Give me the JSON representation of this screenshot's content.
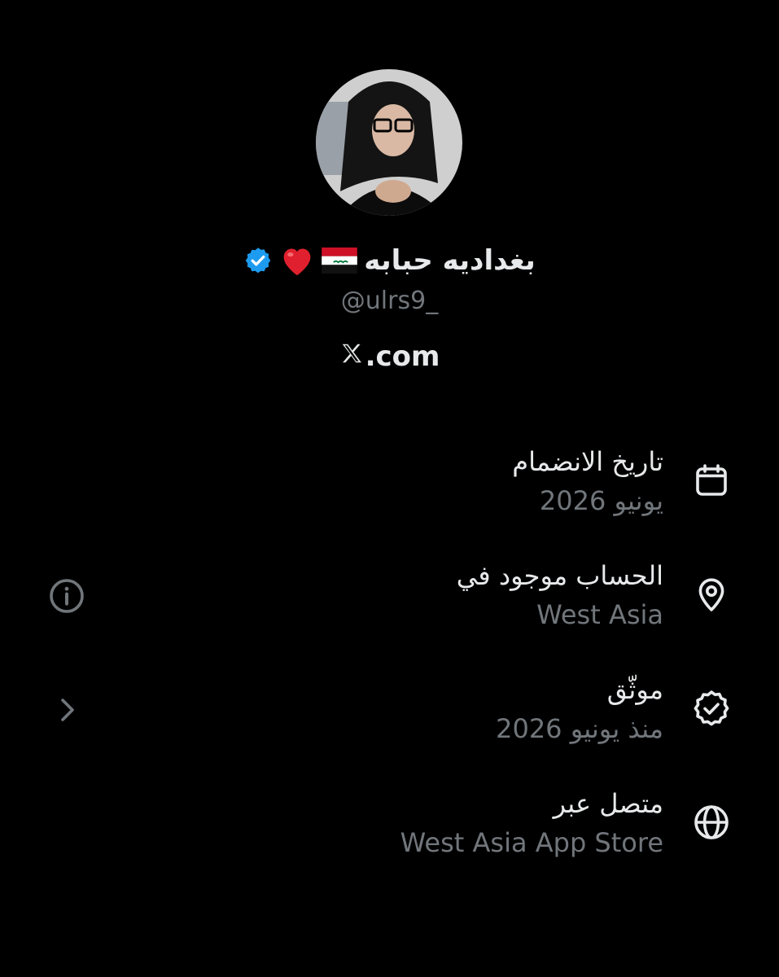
{
  "profile": {
    "display_name": "بغداديه حبابه",
    "handle": "@ulrs9_",
    "link_text": ".com",
    "icons": [
      "verified-badge-icon",
      "heart-icon",
      "iraq-flag-icon",
      "x-logo-icon"
    ]
  },
  "details": [
    {
      "label": "تاريخ الانضمام",
      "value": "يونيو 2026",
      "icon": "calendar-icon"
    },
    {
      "label": "الحساب موجود في",
      "value": "West Asia",
      "icon": "location-pin-icon",
      "left_icon": "info-icon"
    },
    {
      "label": "موثّق",
      "value": "منذ يونيو 2026",
      "icon": "verified-badge-outline-icon",
      "left_icon": "chevron-right-icon"
    },
    {
      "label": "متصل عبر",
      "value": "West Asia App Store",
      "icon": "globe-icon"
    }
  ],
  "colors": {
    "background": "#000000",
    "primary_text": "#e7e9ea",
    "secondary_text": "#71767b",
    "verified_blue": "#1d9bf0"
  }
}
